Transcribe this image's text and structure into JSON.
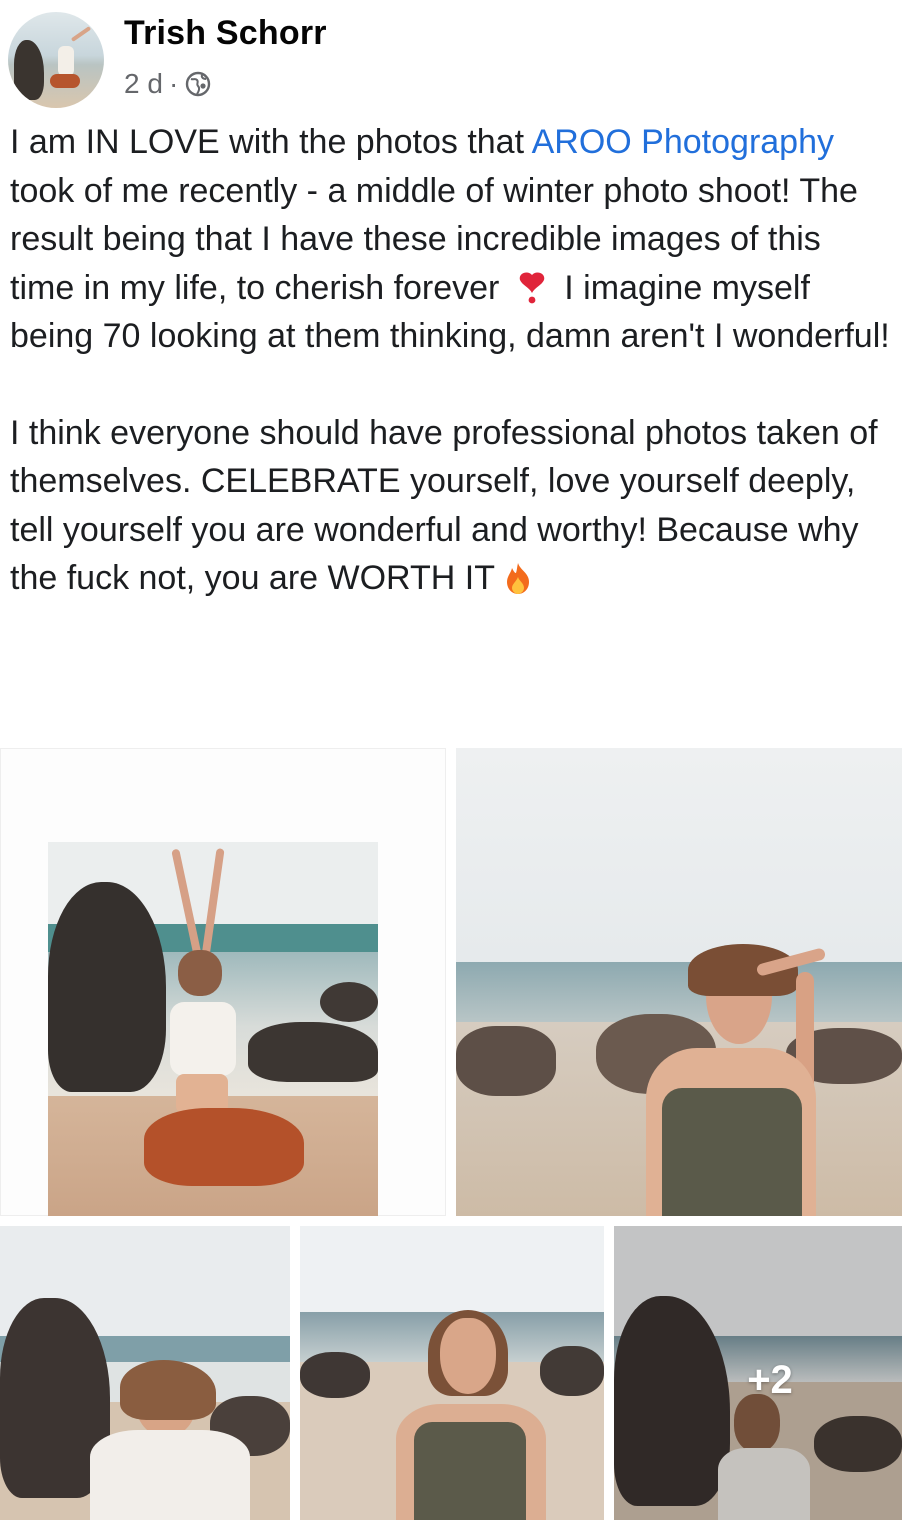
{
  "post": {
    "author": "Trish Schorr",
    "time": "2 d",
    "separator": "·",
    "audience_icon": "globe-icon",
    "text": {
      "p1_a": "I am IN LOVE with the photos that ",
      "p1_link": "AROO Photography",
      "p1_b": " took of me recently - a middle of winter photo shoot! The result being that I have these incredible images of this time in my life, to cherish forever ",
      "p1_emoji": "heart-exclamation-icon",
      "p1_c": " I imagine myself being 70 looking at them thinking, damn aren't I wonderful!",
      "p2_a": "I think everyone should have professional photos taken of themselves. CELEBRATE yourself, love yourself deeply, tell yourself you are wonderful and worthy! Because why the fuck not, you are WORTH IT",
      "p2_emoji": "fire-icon"
    }
  },
  "gallery": {
    "more_count": "+2"
  },
  "colors": {
    "link": "#216fdb",
    "name": "#050505",
    "meta": "#65676b",
    "text": "#1c1e21"
  }
}
